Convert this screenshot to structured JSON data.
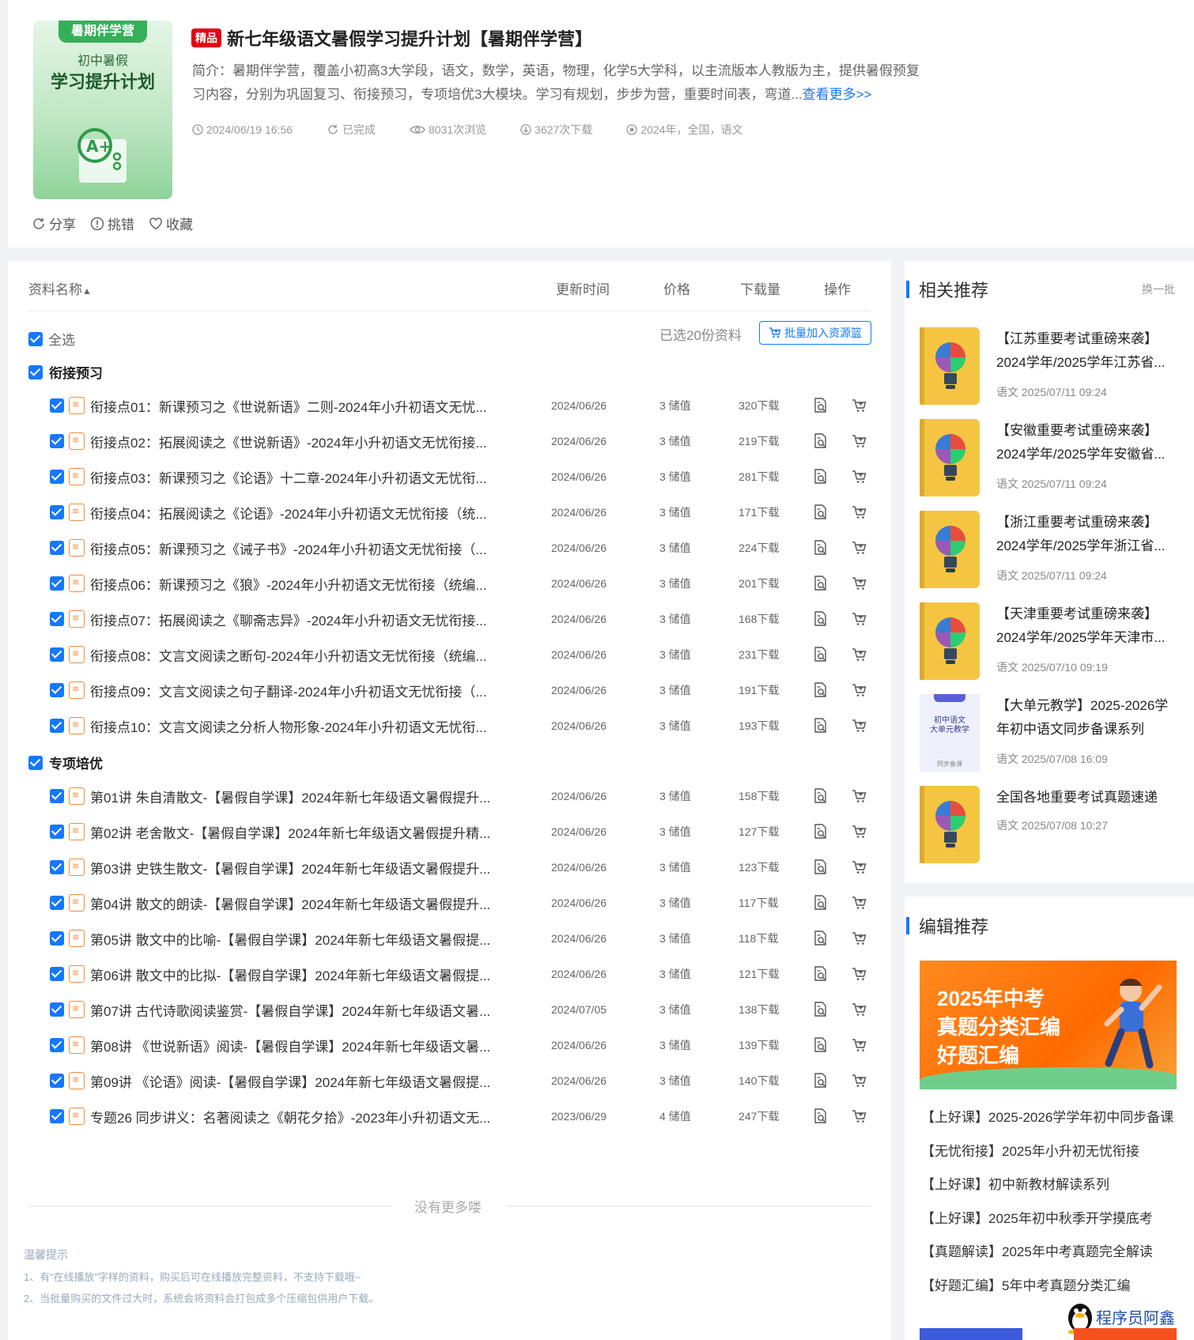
{
  "header": {
    "cover": {
      "tag": "暑期伴学营",
      "subtitle": "初中暑假",
      "title": "学习提升计划"
    },
    "badge": "精品",
    "title": "新七年级语文暑假学习提升计划【暑期伴学营】",
    "intro_line1": "简介：暑期伴学营，覆盖小初高3大学段，语文，数学，英语，物理，化学5大学科，以主流版本人教版为主，提供暑假预复",
    "intro_line2": "习内容，分别为巩固复习、衔接预习，专项培优3大模块。学习有规划，步步为营，重要时间表，弯道...",
    "more_link": "查看更多>>",
    "meta": {
      "date": "2024/06/19 16:56",
      "status": "已完成",
      "views": "8031次浏览",
      "downloads": "3627次下载",
      "tags": "2024年，全国，语文"
    },
    "actions": {
      "share": "分享",
      "report": "挑错",
      "favorite": "收藏"
    }
  },
  "list": {
    "columns": {
      "name": "资料名称",
      "updated": "更新时间",
      "price": "价格",
      "downloads": "下载量",
      "actions": "操作"
    },
    "select_all": "全选",
    "selected_count": "已选20份资料",
    "batch_button": "批量加入资源篮",
    "groups": [
      {
        "title": "衔接预习",
        "rows": [
          {
            "name": "衔接点01：新课预习之《世说新语》二则-2024年小升初语文无忧...",
            "date": "2024/06/26",
            "price": "3 储值",
            "downloads": "320下载"
          },
          {
            "name": "衔接点02：拓展阅读之《世说新语》-2024年小升初语文无忧衔接...",
            "date": "2024/06/26",
            "price": "3 储值",
            "downloads": "219下载"
          },
          {
            "name": "衔接点03：新课预习之《论语》十二章-2024年小升初语文无忧衔...",
            "date": "2024/06/26",
            "price": "3 储值",
            "downloads": "281下载"
          },
          {
            "name": "衔接点04：拓展阅读之《论语》-2024年小升初语文无忧衔接（统...",
            "date": "2024/06/26",
            "price": "3 储值",
            "downloads": "171下载"
          },
          {
            "name": "衔接点05：新课预习之《诫子书》-2024年小升初语文无忧衔接（...",
            "date": "2024/06/26",
            "price": "3 储值",
            "downloads": "224下载"
          },
          {
            "name": "衔接点06：新课预习之《狼》-2024年小升初语文无忧衔接（统编...",
            "date": "2024/06/26",
            "price": "3 储值",
            "downloads": "201下载"
          },
          {
            "name": "衔接点07：拓展阅读之《聊斋志异》-2024年小升初语文无忧衔接...",
            "date": "2024/06/26",
            "price": "3 储值",
            "downloads": "168下载"
          },
          {
            "name": "衔接点08：文言文阅读之断句-2024年小升初语文无忧衔接（统编...",
            "date": "2024/06/26",
            "price": "3 储值",
            "downloads": "231下载"
          },
          {
            "name": "衔接点09：文言文阅读之句子翻译-2024年小升初语文无忧衔接（...",
            "date": "2024/06/26",
            "price": "3 储值",
            "downloads": "191下载"
          },
          {
            "name": "衔接点10：文言文阅读之分析人物形象-2024年小升初语文无忧衔...",
            "date": "2024/06/26",
            "price": "3 储值",
            "downloads": "193下载"
          }
        ]
      },
      {
        "title": "专项培优",
        "rows": [
          {
            "name": "第01讲 朱自清散文-【暑假自学课】2024年新七年级语文暑假提升...",
            "date": "2024/06/26",
            "price": "3 储值",
            "downloads": "158下载"
          },
          {
            "name": "第02讲 老舍散文-【暑假自学课】2024年新七年级语文暑假提升精...",
            "date": "2024/06/26",
            "price": "3 储值",
            "downloads": "127下载"
          },
          {
            "name": "第03讲 史铁生散文-【暑假自学课】2024年新七年级语文暑假提升...",
            "date": "2024/06/26",
            "price": "3 储值",
            "downloads": "123下载"
          },
          {
            "name": "第04讲 散文的朗读-【暑假自学课】2024年新七年级语文暑假提升...",
            "date": "2024/06/26",
            "price": "3 储值",
            "downloads": "117下载"
          },
          {
            "name": "第05讲 散文中的比喻-【暑假自学课】2024年新七年级语文暑假提...",
            "date": "2024/06/26",
            "price": "3 储值",
            "downloads": "118下载"
          },
          {
            "name": "第06讲 散文中的比拟-【暑假自学课】2024年新七年级语文暑假提...",
            "date": "2024/06/26",
            "price": "3 储值",
            "downloads": "121下载"
          },
          {
            "name": "第07讲 古代诗歌阅读鉴赏-【暑假自学课】2024年新七年级语文暑...",
            "date": "2024/07/05",
            "price": "3 储值",
            "downloads": "138下载"
          },
          {
            "name": "第08讲 《世说新语》阅读-【暑假自学课】2024年新七年级语文暑...",
            "date": "2024/06/26",
            "price": "3 储值",
            "downloads": "139下载"
          },
          {
            "name": "第09讲 《论语》阅读-【暑假自学课】2024年新七年级语文暑假提...",
            "date": "2024/06/26",
            "price": "3 储值",
            "downloads": "140下载"
          },
          {
            "name": "专题26 同步讲义：名著阅读之《朝花夕拾》-2023年小升初语文无...",
            "date": "2023/06/29",
            "price": "4 储值",
            "downloads": "247下载"
          }
        ]
      }
    ],
    "no_more": "没有更多喽",
    "tips_title": "温馨提示",
    "tip1": "1、有“在线播放”字样的资料，购买后可在线播放完整资料，不支持下载哦~",
    "tip2": "2、当批量购买的文件过大时，系统会将资料会打包成多个压缩包供用户下载。"
  },
  "related": {
    "title": "相关推荐",
    "swap": "换一批",
    "items": [
      {
        "line1": "【江苏重要考试重磅来袭】",
        "line2": "2024学年/2025学年江苏省...",
        "meta": "语文 2025/07/11 09:24",
        "cover": "bulb"
      },
      {
        "line1": "【安徽重要考试重磅来袭】",
        "line2": "2024学年/2025学年安徽省...",
        "meta": "语文 2025/07/11 09:24",
        "cover": "bulb"
      },
      {
        "line1": "【浙江重要考试重磅来袭】",
        "line2": "2024学年/2025学年浙江省...",
        "meta": "语文 2025/07/11 09:24",
        "cover": "bulb"
      },
      {
        "line1": "【天津重要考试重磅来袭】",
        "line2": "2024学年/2025学年天津市...",
        "meta": "语文 2025/07/10 09:19",
        "cover": "bulb"
      },
      {
        "line1": "【大单元教学】2025-2026学",
        "line2": "年初中语文同步备课系列",
        "meta": "语文 2025/07/08 16:09",
        "cover": "unit",
        "cover_title1": "初中语文",
        "cover_title2": "大单元教学",
        "cover_foot": "同步备课"
      },
      {
        "line1": "全国各地重要考试真题速递",
        "line2": "",
        "meta": "语文 2025/07/08 10:27",
        "cover": "bulb"
      }
    ]
  },
  "editor": {
    "title": "编辑推荐",
    "banner": {
      "l1": "2025年中考",
      "l2": "真题分类汇编",
      "l3": "好题汇编"
    },
    "items": [
      "【上好课】2025-2026学学年初中同步备课",
      "【无忧衔接】2025年小升初无忧衔接",
      "【上好课】初中新教材解读系列",
      "【上好课】2025年初中秋季开学摸底考",
      "【真题解读】2025年中考真题完全解读",
      "【好题汇编】5年中考真题分类汇编"
    ],
    "watermark": "程序员阿鑫"
  },
  "colors": {
    "accent": "#1677ff",
    "badge": "#e60012",
    "file_icon": "#f58a3c"
  }
}
